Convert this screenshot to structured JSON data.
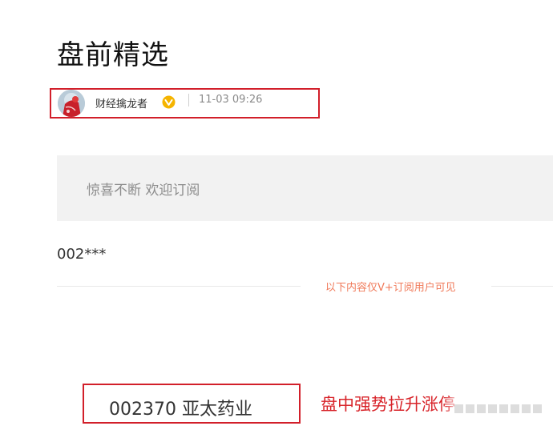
{
  "article": {
    "title": "盘前精选"
  },
  "author": {
    "name": "财经擒龙者",
    "verified_icon": "verified-badge-icon",
    "verified_color": "#f5b400",
    "time": "11-03 09:26"
  },
  "promo": {
    "text": "惊喜不断 欢迎订阅"
  },
  "content": {
    "code_preview": "002***",
    "notice": "以下内容仅V+订阅用户可见",
    "stock": "002370 亚太药业",
    "annotation": "盘中强势拉升涨停"
  },
  "colors": {
    "highlight_border": "#d21f2a",
    "notice_text": "#f07a5a",
    "annotation_text": "#d8242a",
    "banner_bg": "#f2f2f2"
  }
}
